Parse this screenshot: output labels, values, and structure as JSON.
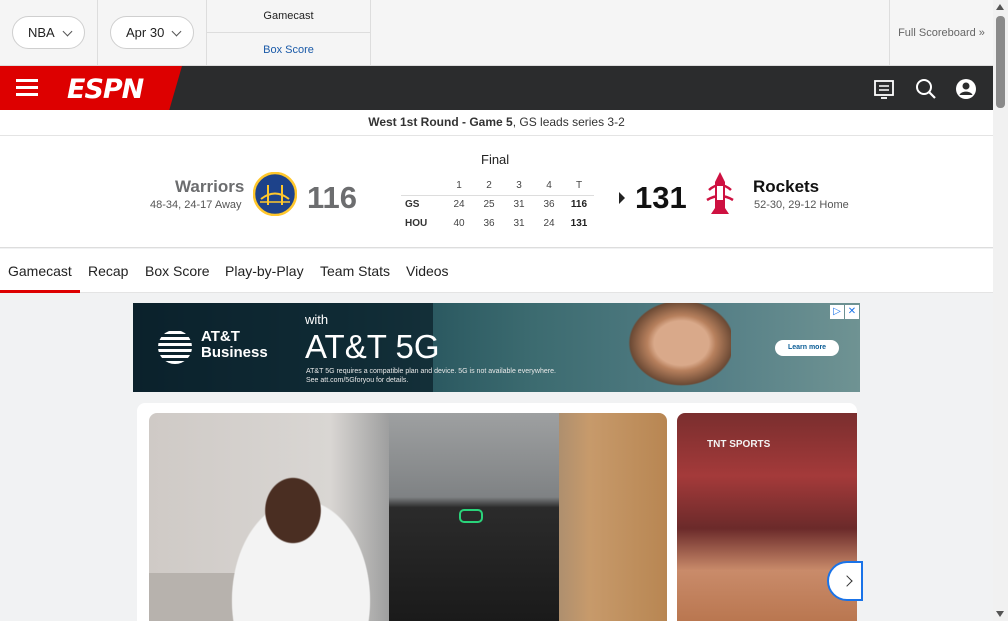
{
  "topstrip": {
    "league": "NBA",
    "date": "Apr 30",
    "gamecast_label": "Gamecast",
    "boxscore_label": "Box Score",
    "full_scoreboard": "Full Scoreboard »"
  },
  "nav": {
    "logo_text": "ESPN",
    "icons": [
      "menu-icon",
      "watch-icon",
      "search-icon",
      "profile-icon"
    ]
  },
  "matchup": {
    "series_bold": "West 1st Round - Game 5",
    "series_rest": ", GS leads series 3-2"
  },
  "game": {
    "status": "Final",
    "away": {
      "name": "Warriors",
      "record": "48-34, 24-17 Away",
      "score": "116",
      "abbr": "GS",
      "logo_color": "#1d428a"
    },
    "home": {
      "name": "Rockets",
      "record": "52-30, 29-12 Home",
      "score": "131",
      "abbr": "HOU",
      "logo_color": "#ce1141"
    },
    "linescore": {
      "headers": [
        "1",
        "2",
        "3",
        "4",
        "T"
      ],
      "rows": [
        {
          "team": "GS",
          "q": [
            "24",
            "25",
            "31",
            "36"
          ],
          "t": "116"
        },
        {
          "team": "HOU",
          "q": [
            "40",
            "36",
            "31",
            "24"
          ],
          "t": "131"
        }
      ]
    }
  },
  "tabs": [
    "Gamecast",
    "Recap",
    "Box Score",
    "Play-by-Play",
    "Team Stats",
    "Videos"
  ],
  "active_tab": "Gamecast",
  "ad": {
    "brand_line1": "AT&T",
    "brand_line2": "Business",
    "with": "with",
    "headline": "AT&T 5G",
    "fine1": "AT&T 5G requires a compatible plan and device. 5G is not available everywhere.",
    "fine2": "See att.com/5Gforyou for details.",
    "cta": "Learn more"
  },
  "video2": {
    "watermark": "TNT SPORTS"
  },
  "colors": {
    "espn_red": "#dd0000",
    "nav_dark": "#2b2c2d",
    "link_blue": "#1a5aa8"
  }
}
